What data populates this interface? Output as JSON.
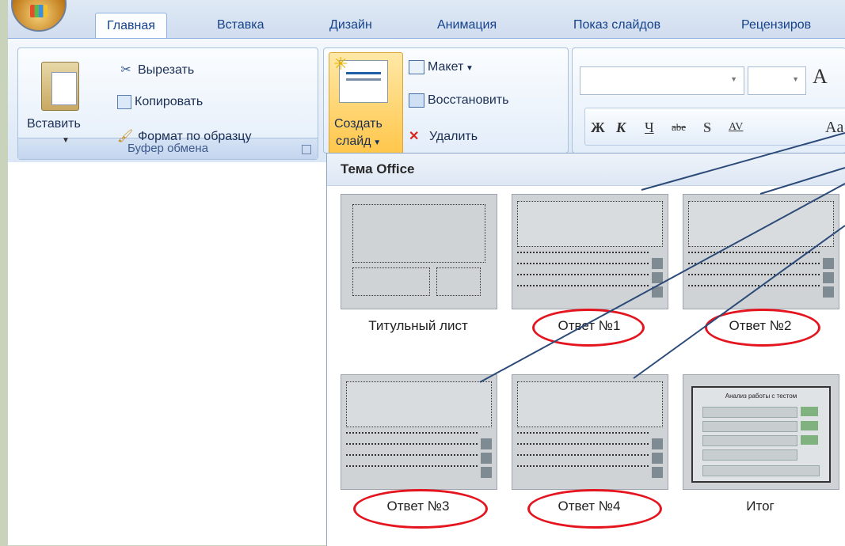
{
  "tabs": [
    {
      "label": "Главная",
      "active": true
    },
    {
      "label": "Вставка"
    },
    {
      "label": "Дизайн"
    },
    {
      "label": "Анимация"
    },
    {
      "label": "Показ слайдов"
    },
    {
      "label": "Рецензиров"
    }
  ],
  "clipboard": {
    "paste_label": "Вставить",
    "cut_label": "Вырезать",
    "copy_label": "Копировать",
    "format_label": "Формат по образцу",
    "group_label": "Буфер обмена"
  },
  "slides": {
    "new_slide_line1": "Создать",
    "new_slide_line2": "слайд",
    "layout_label": "Макет",
    "reset_label": "Восстановить",
    "delete_label": "Удалить"
  },
  "font": {
    "grow_label": "A",
    "bold": "Ж",
    "italic": "К",
    "underline": "Ч",
    "strike": "abe",
    "shadow": "S",
    "spacing": "AV",
    "case": "Aa"
  },
  "gallery": {
    "title": "Тема Office",
    "layouts": [
      {
        "label": "Титульный лист",
        "circled": false
      },
      {
        "label": "Ответ №1",
        "circled": true
      },
      {
        "label": "Ответ №2",
        "circled": true
      },
      {
        "label": "Ответ №3",
        "circled": true
      },
      {
        "label": "Ответ №4",
        "circled": true
      },
      {
        "label": "Итог",
        "circled": false
      }
    ],
    "summary_thumb_title": "Анализ работы с тестом"
  },
  "colors": {
    "annotation_circle": "#e4151f",
    "annotation_line": "#2c4a78",
    "accent": "#15428b"
  }
}
